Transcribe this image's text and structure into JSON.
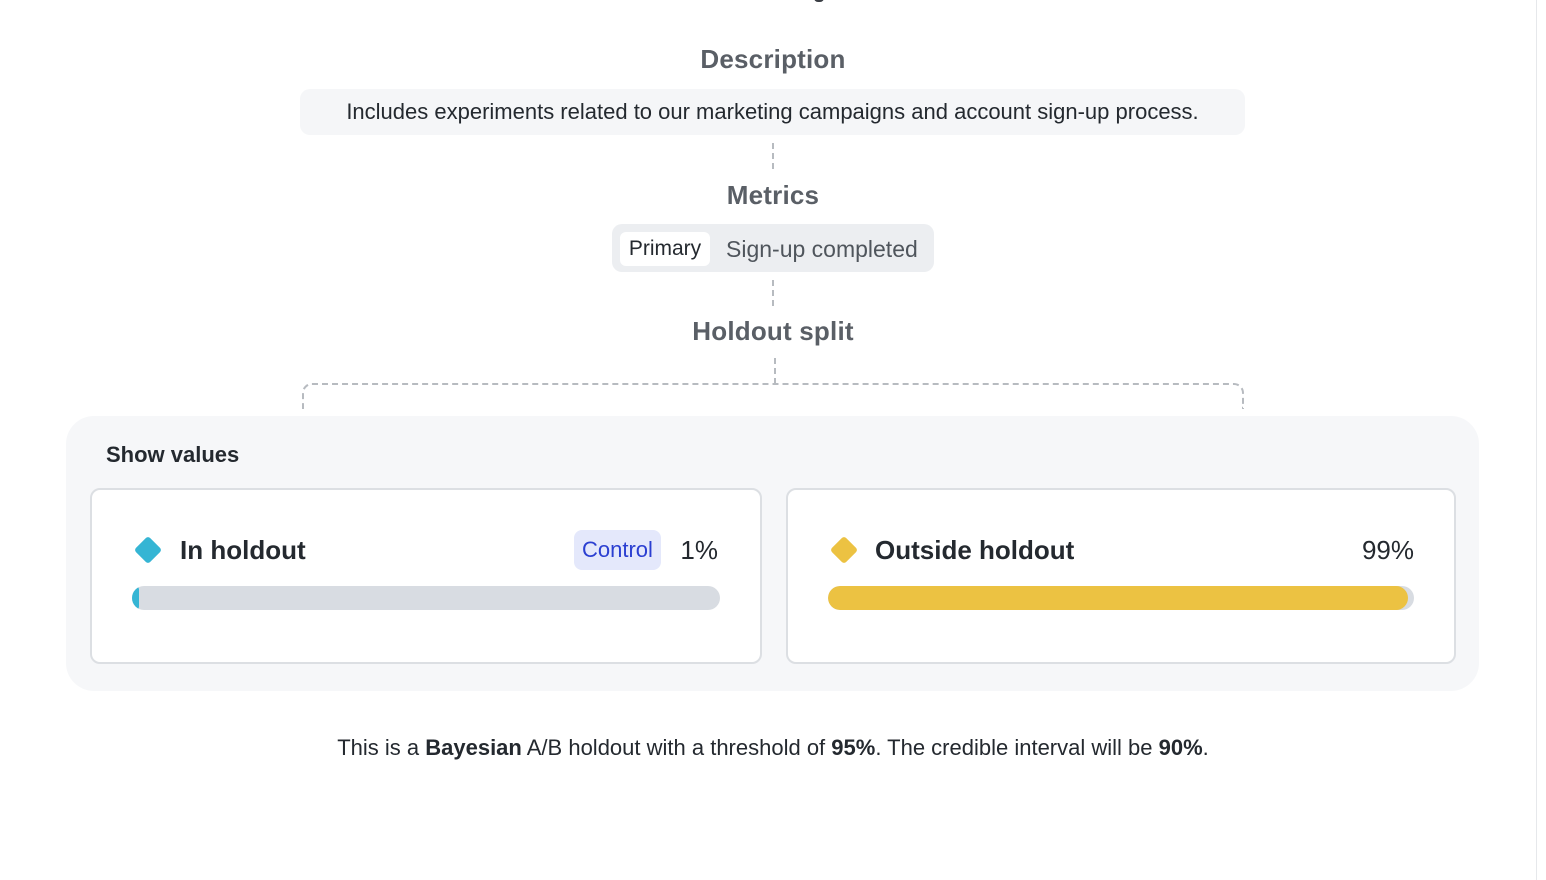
{
  "description": {
    "title": "Description",
    "text": "Includes experiments related to our marketing campaigns and account sign-up process."
  },
  "metrics": {
    "title": "Metrics",
    "tag": "Primary",
    "name": "Sign-up completed"
  },
  "holdout_split": {
    "title": "Holdout split",
    "show_values_label": "Show values",
    "groups": [
      {
        "label": "In holdout",
        "badge": "Control",
        "percent_label": "1%",
        "percent": 1,
        "color": "#35b5d4",
        "icon": "diamond-icon"
      },
      {
        "label": "Outside holdout",
        "percent_label": "99%",
        "percent": 99,
        "color": "#ecc242",
        "icon": "diamond-icon"
      }
    ]
  },
  "summary": {
    "prefix": "This is a ",
    "method": "Bayesian",
    "middle": " A/B holdout with a threshold of ",
    "threshold": "95%",
    "middle2": ". The credible interval will be ",
    "interval": "90%",
    "suffix": "."
  }
}
